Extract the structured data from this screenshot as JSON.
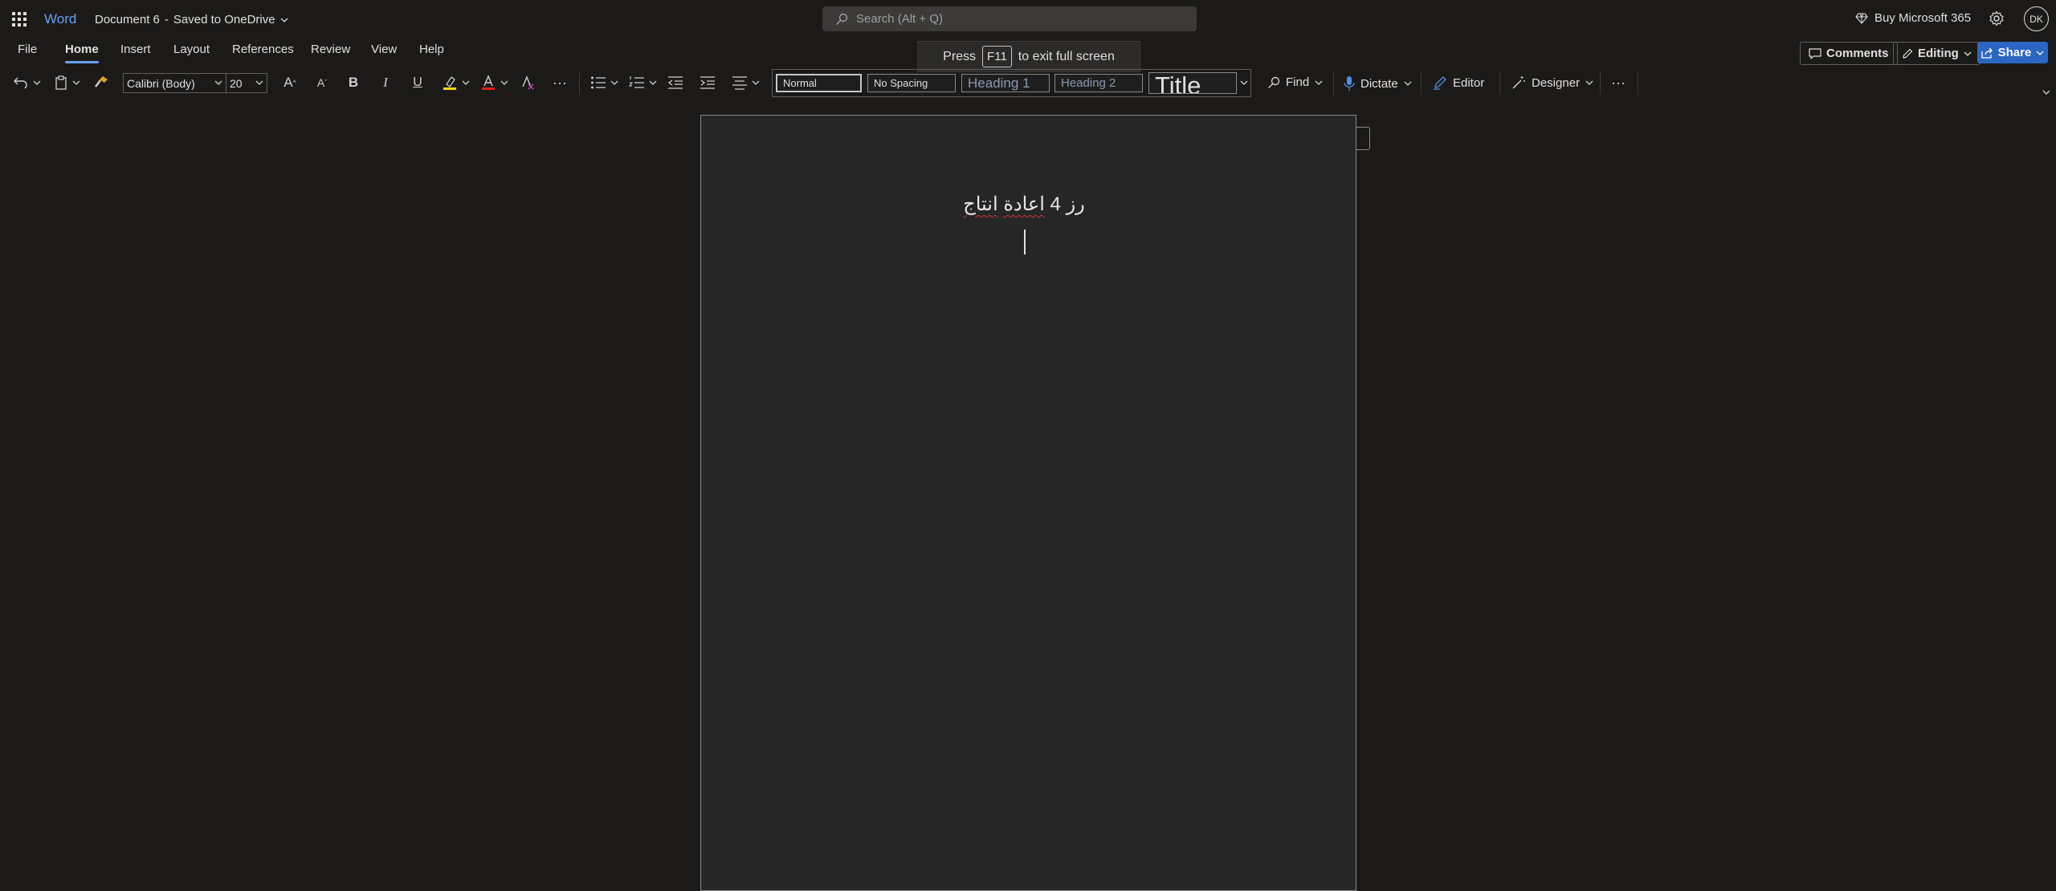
{
  "titlebar": {
    "app_name": "Word",
    "doc_title": "Document 6",
    "save_status": "Saved to OneDrive",
    "search_placeholder": "Search (Alt + Q)",
    "buy_label": "Buy Microsoft 365",
    "avatar_initials": "DK"
  },
  "tabs": [
    "File",
    "Home",
    "Insert",
    "Layout",
    "References",
    "Review",
    "View",
    "Help"
  ],
  "active_tab": "Home",
  "fullscreen_toast": {
    "prefix": "Press",
    "key": "F11",
    "suffix": "to exit full screen"
  },
  "right_buttons": {
    "comments": "Comments",
    "editing": "Editing",
    "share": "Share"
  },
  "ribbon": {
    "font_name": "Calibri (Body)",
    "font_size": "20",
    "styles": [
      "Normal",
      "No Spacing",
      "Heading 1",
      "Heading 2",
      "Title"
    ],
    "find_label": "Find",
    "dictate_label": "Dictate",
    "editor_label": "Editor",
    "designer_label": "Designer",
    "colors": {
      "highlight": "#ffd800",
      "font_color": "#e02020",
      "accent": "#2b66c4"
    }
  },
  "document": {
    "words": [
      "رز",
      "4",
      "اعادة",
      "انتاج"
    ]
  }
}
